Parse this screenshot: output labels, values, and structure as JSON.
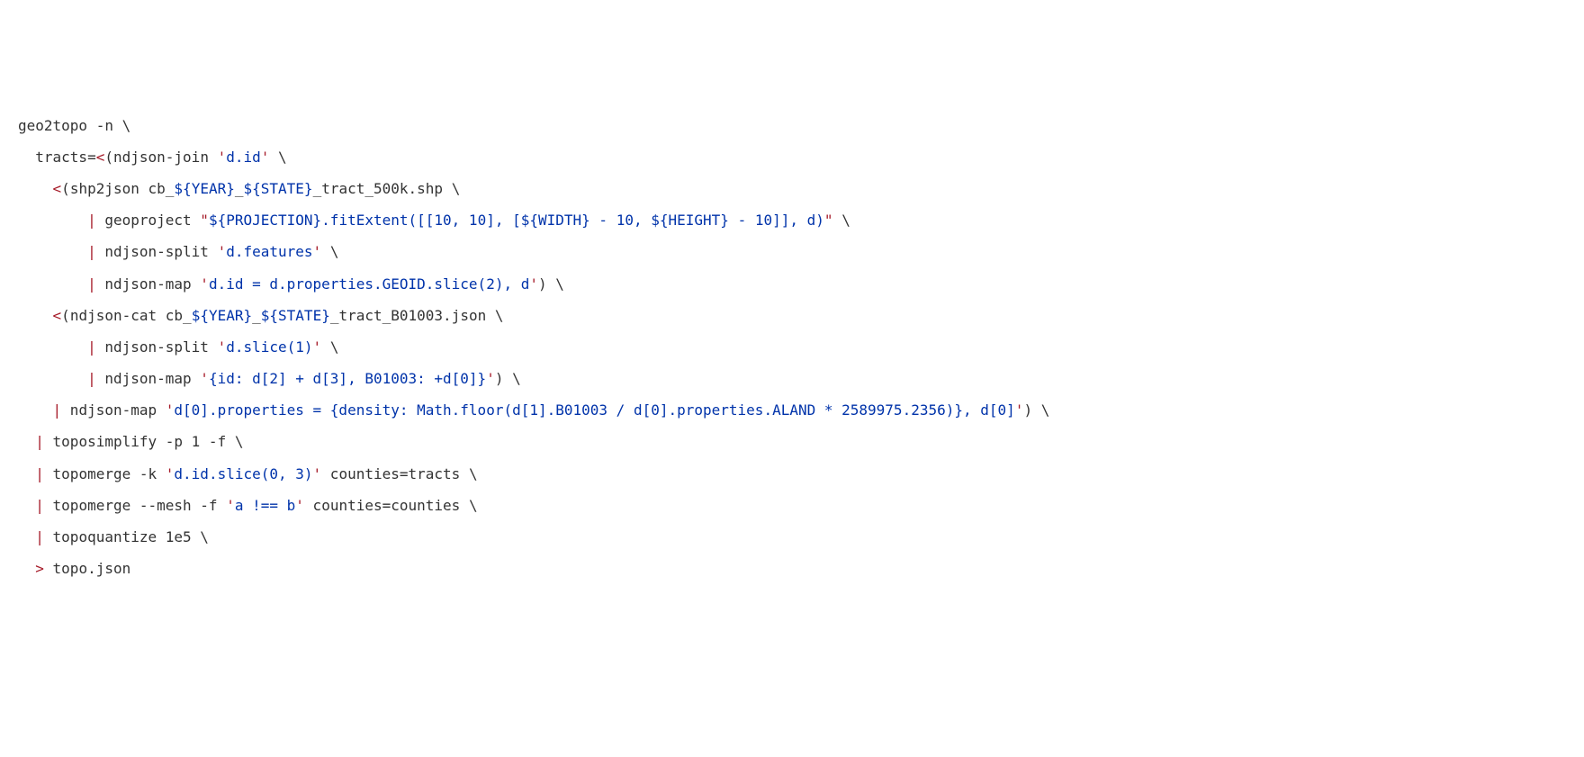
{
  "lines": [
    [
      {
        "t": "geo2topo -n ",
        "cls": "cmd"
      },
      {
        "t": "\\",
        "cls": "cont"
      }
    ],
    [
      {
        "t": "  tracts=",
        "cls": "cmd"
      },
      {
        "t": "<",
        "cls": "pipe"
      },
      {
        "t": "(",
        "cls": "cmd"
      },
      {
        "t": "ndjson-join ",
        "cls": "cmd"
      },
      {
        "t": "'",
        "cls": "str"
      },
      {
        "t": "d.id",
        "cls": "strc"
      },
      {
        "t": "'",
        "cls": "str"
      },
      {
        "t": " ",
        "cls": "cmd"
      },
      {
        "t": "\\",
        "cls": "cont"
      }
    ],
    [
      {
        "t": "    ",
        "cls": "cmd"
      },
      {
        "t": "<",
        "cls": "pipe"
      },
      {
        "t": "(",
        "cls": "cmd"
      },
      {
        "t": "shp2json ",
        "cls": "cmd"
      },
      {
        "t": "cb_",
        "cls": "fname"
      },
      {
        "t": "${YEAR}",
        "cls": "var"
      },
      {
        "t": "_",
        "cls": "fname"
      },
      {
        "t": "${STATE}",
        "cls": "var"
      },
      {
        "t": "_tract_500k.shp ",
        "cls": "fname"
      },
      {
        "t": "\\",
        "cls": "cont"
      }
    ],
    [
      {
        "t": "        ",
        "cls": "cmd"
      },
      {
        "t": "|",
        "cls": "pipe"
      },
      {
        "t": " geoproject ",
        "cls": "cmd"
      },
      {
        "t": "\"",
        "cls": "str"
      },
      {
        "t": "${PROJECTION}",
        "cls": "var"
      },
      {
        "t": ".fitExtent([[10, 10], [",
        "cls": "strc"
      },
      {
        "t": "${WIDTH}",
        "cls": "var"
      },
      {
        "t": " - 10, ",
        "cls": "strc"
      },
      {
        "t": "${HEIGHT}",
        "cls": "var"
      },
      {
        "t": " - 10]], d)",
        "cls": "strc"
      },
      {
        "t": "\"",
        "cls": "str"
      },
      {
        "t": " ",
        "cls": "cmd"
      },
      {
        "t": "\\",
        "cls": "cont"
      }
    ],
    [
      {
        "t": "        ",
        "cls": "cmd"
      },
      {
        "t": "|",
        "cls": "pipe"
      },
      {
        "t": " ndjson-split ",
        "cls": "cmd"
      },
      {
        "t": "'",
        "cls": "str"
      },
      {
        "t": "d.features",
        "cls": "strc"
      },
      {
        "t": "'",
        "cls": "str"
      },
      {
        "t": " ",
        "cls": "cmd"
      },
      {
        "t": "\\",
        "cls": "cont"
      }
    ],
    [
      {
        "t": "        ",
        "cls": "cmd"
      },
      {
        "t": "|",
        "cls": "pipe"
      },
      {
        "t": " ndjson-map ",
        "cls": "cmd"
      },
      {
        "t": "'",
        "cls": "str"
      },
      {
        "t": "d.id = d.properties.GEOID.slice(2), d",
        "cls": "strc"
      },
      {
        "t": "'",
        "cls": "str"
      },
      {
        "t": ")",
        "cls": "cmd"
      },
      {
        "t": " ",
        "cls": "cmd"
      },
      {
        "t": "\\",
        "cls": "cont"
      }
    ],
    [
      {
        "t": "    ",
        "cls": "cmd"
      },
      {
        "t": "<",
        "cls": "pipe"
      },
      {
        "t": "(",
        "cls": "cmd"
      },
      {
        "t": "ndjson-cat ",
        "cls": "cmd"
      },
      {
        "t": "cb_",
        "cls": "fname"
      },
      {
        "t": "${YEAR}",
        "cls": "var"
      },
      {
        "t": "_",
        "cls": "fname"
      },
      {
        "t": "${STATE}",
        "cls": "var"
      },
      {
        "t": "_tract_B01003.json ",
        "cls": "fname"
      },
      {
        "t": "\\",
        "cls": "cont"
      }
    ],
    [
      {
        "t": "        ",
        "cls": "cmd"
      },
      {
        "t": "|",
        "cls": "pipe"
      },
      {
        "t": " ndjson-split ",
        "cls": "cmd"
      },
      {
        "t": "'",
        "cls": "str"
      },
      {
        "t": "d.slice(1)",
        "cls": "strc"
      },
      {
        "t": "'",
        "cls": "str"
      },
      {
        "t": " ",
        "cls": "cmd"
      },
      {
        "t": "\\",
        "cls": "cont"
      }
    ],
    [
      {
        "t": "        ",
        "cls": "cmd"
      },
      {
        "t": "|",
        "cls": "pipe"
      },
      {
        "t": " ndjson-map ",
        "cls": "cmd"
      },
      {
        "t": "'",
        "cls": "str"
      },
      {
        "t": "{id: d[2] + d[3], B01003: +d[0]}",
        "cls": "strc"
      },
      {
        "t": "'",
        "cls": "str"
      },
      {
        "t": ")",
        "cls": "cmd"
      },
      {
        "t": " ",
        "cls": "cmd"
      },
      {
        "t": "\\",
        "cls": "cont"
      }
    ],
    [
      {
        "t": "    ",
        "cls": "cmd"
      },
      {
        "t": "|",
        "cls": "pipe"
      },
      {
        "t": " ndjson-map ",
        "cls": "cmd"
      },
      {
        "t": "'",
        "cls": "str"
      },
      {
        "t": "d[0].properties = {density: Math.floor(d[1].B01003 / d[0].properties.ALAND * 2589975.2356)}, d[0]",
        "cls": "strc"
      },
      {
        "t": "'",
        "cls": "str"
      },
      {
        "t": ")",
        "cls": "cmd"
      },
      {
        "t": " ",
        "cls": "cmd"
      },
      {
        "t": "\\",
        "cls": "cont"
      }
    ],
    [
      {
        "t": "  ",
        "cls": "cmd"
      },
      {
        "t": "|",
        "cls": "pipe"
      },
      {
        "t": " toposimplify -p 1 -f ",
        "cls": "cmd"
      },
      {
        "t": "\\",
        "cls": "cont"
      }
    ],
    [
      {
        "t": "  ",
        "cls": "cmd"
      },
      {
        "t": "|",
        "cls": "pipe"
      },
      {
        "t": " topomerge -k ",
        "cls": "cmd"
      },
      {
        "t": "'",
        "cls": "str"
      },
      {
        "t": "d.id.slice(0, 3)",
        "cls": "strc"
      },
      {
        "t": "'",
        "cls": "str"
      },
      {
        "t": " counties=tracts ",
        "cls": "cmd"
      },
      {
        "t": "\\",
        "cls": "cont"
      }
    ],
    [
      {
        "t": "  ",
        "cls": "cmd"
      },
      {
        "t": "|",
        "cls": "pipe"
      },
      {
        "t": " topomerge --mesh -f ",
        "cls": "cmd"
      },
      {
        "t": "'",
        "cls": "str"
      },
      {
        "t": "a !== b",
        "cls": "strc"
      },
      {
        "t": "'",
        "cls": "str"
      },
      {
        "t": " counties=counties ",
        "cls": "cmd"
      },
      {
        "t": "\\",
        "cls": "cont"
      }
    ],
    [
      {
        "t": "  ",
        "cls": "cmd"
      },
      {
        "t": "|",
        "cls": "pipe"
      },
      {
        "t": " topoquantize 1e5 ",
        "cls": "cmd"
      },
      {
        "t": "\\",
        "cls": "cont"
      }
    ],
    [
      {
        "t": "  ",
        "cls": "cmd"
      },
      {
        "t": ">",
        "cls": "pipe"
      },
      {
        "t": " topo.json",
        "cls": "cmd"
      }
    ]
  ]
}
